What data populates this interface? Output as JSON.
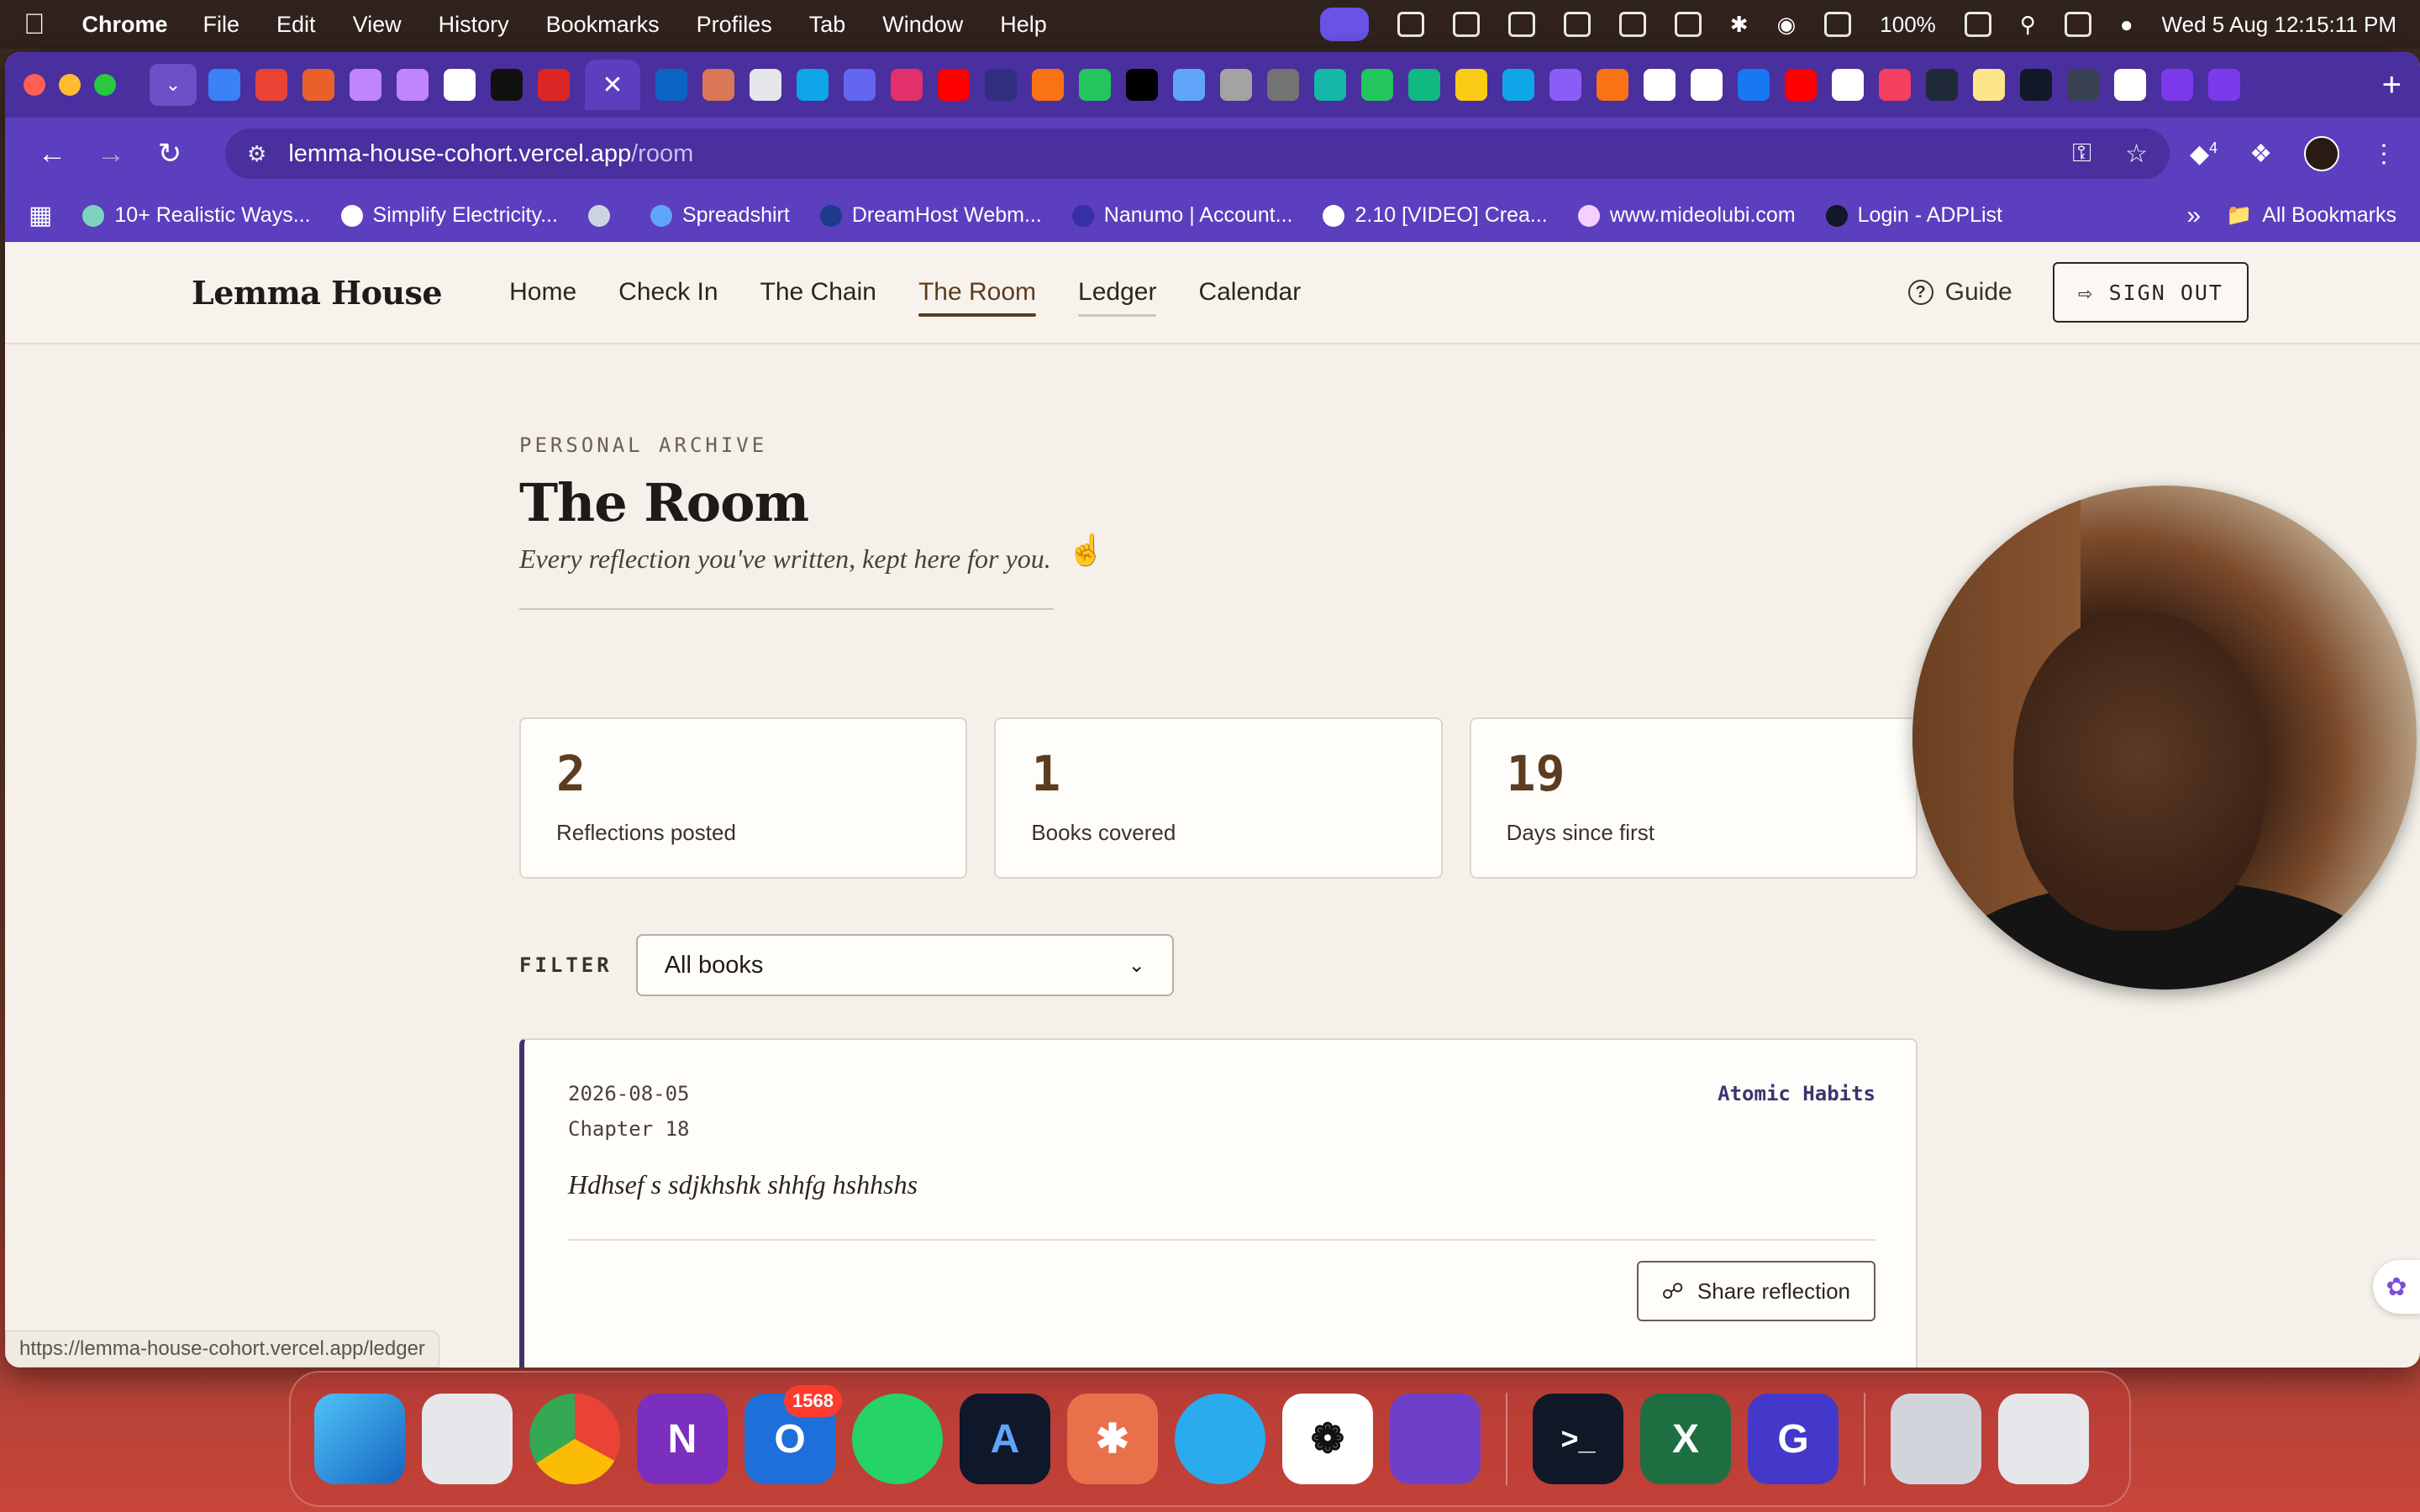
{
  "menubar": {
    "app_name": "Chrome",
    "menus": [
      "File",
      "Edit",
      "View",
      "History",
      "Bookmarks",
      "Profiles",
      "Tab",
      "Window",
      "Help"
    ],
    "battery": "100%",
    "datetime": "Wed 5 Aug  12:15:11 PM"
  },
  "browser": {
    "url_host": "lemma-house-cohort.vercel.app",
    "url_path": "/room",
    "extensions_badge": "4",
    "bookmarks": [
      "10+ Realistic Ways...",
      "Simplify Electricity...",
      "",
      "Spreadshirt",
      "DreamHost Webm...",
      "Nanumo | Account...",
      "2.10 [VIDEO] Crea...",
      "www.mideolubi.com",
      "Login - ADPList"
    ],
    "all_bookmarks": "All Bookmarks",
    "status_url": "https://lemma-house-cohort.vercel.app/ledger"
  },
  "site": {
    "logo": "Lemma House",
    "nav": {
      "home": "Home",
      "check_in": "Check In",
      "chain": "The Chain",
      "room": "The Room",
      "ledger": "Ledger",
      "calendar": "Calendar"
    },
    "guide": "Guide",
    "sign_out": "SIGN OUT"
  },
  "page": {
    "eyebrow": "PERSONAL ARCHIVE",
    "title": "The Room",
    "subtitle": "Every reflection you've written, kept here for you.",
    "stats": [
      {
        "value": "2",
        "label": "Reflections posted"
      },
      {
        "value": "1",
        "label": "Books covered"
      },
      {
        "value": "19",
        "label": "Days since first"
      }
    ],
    "filter": {
      "label": "FILTER",
      "selected": "All books"
    },
    "reflections": [
      {
        "date": "2026-08-05",
        "chapter": "Chapter 18",
        "book": "Atomic Habits",
        "text": "Hdhsef s sdjkhshk shhfg hshhshs",
        "share_label": "Share reflection"
      }
    ]
  },
  "dock": {
    "outlook_badge": "1568"
  },
  "colors": {
    "accent_brown": "#5c3d20",
    "accent_indigo": "#3d3570",
    "chrome_purple": "#5b3fbe",
    "page_bg": "#f5f1ea"
  }
}
